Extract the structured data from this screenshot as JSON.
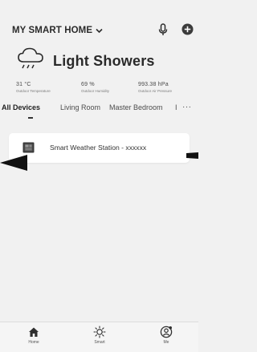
{
  "header": {
    "home_title": "MY SMART HOME",
    "mic_icon": "microphone-icon",
    "add_icon": "plus-circle-icon"
  },
  "weather": {
    "icon": "cloud-rain-icon",
    "condition": "Light Showers",
    "stats": [
      {
        "value": "31 °C",
        "label": "Outdoor Temperature"
      },
      {
        "value": "69 %",
        "label": "Outdoor Humidity"
      },
      {
        "value": "993.38 hPa",
        "label": "Outdoor Air Pressure"
      }
    ]
  },
  "tabs": {
    "items": [
      "All Devices",
      "Living Room",
      "Master Bedroom",
      "I"
    ],
    "active_index": 0,
    "more": "···"
  },
  "devices": [
    {
      "icon": "weather-station-icon",
      "name": "Smart Weather Station - xxxxxx"
    }
  ],
  "bottom_nav": {
    "items": [
      {
        "label": "Home",
        "icon": "home-icon"
      },
      {
        "label": "Smart",
        "icon": "sun-icon"
      },
      {
        "label": "Me",
        "icon": "user-icon"
      }
    ]
  }
}
